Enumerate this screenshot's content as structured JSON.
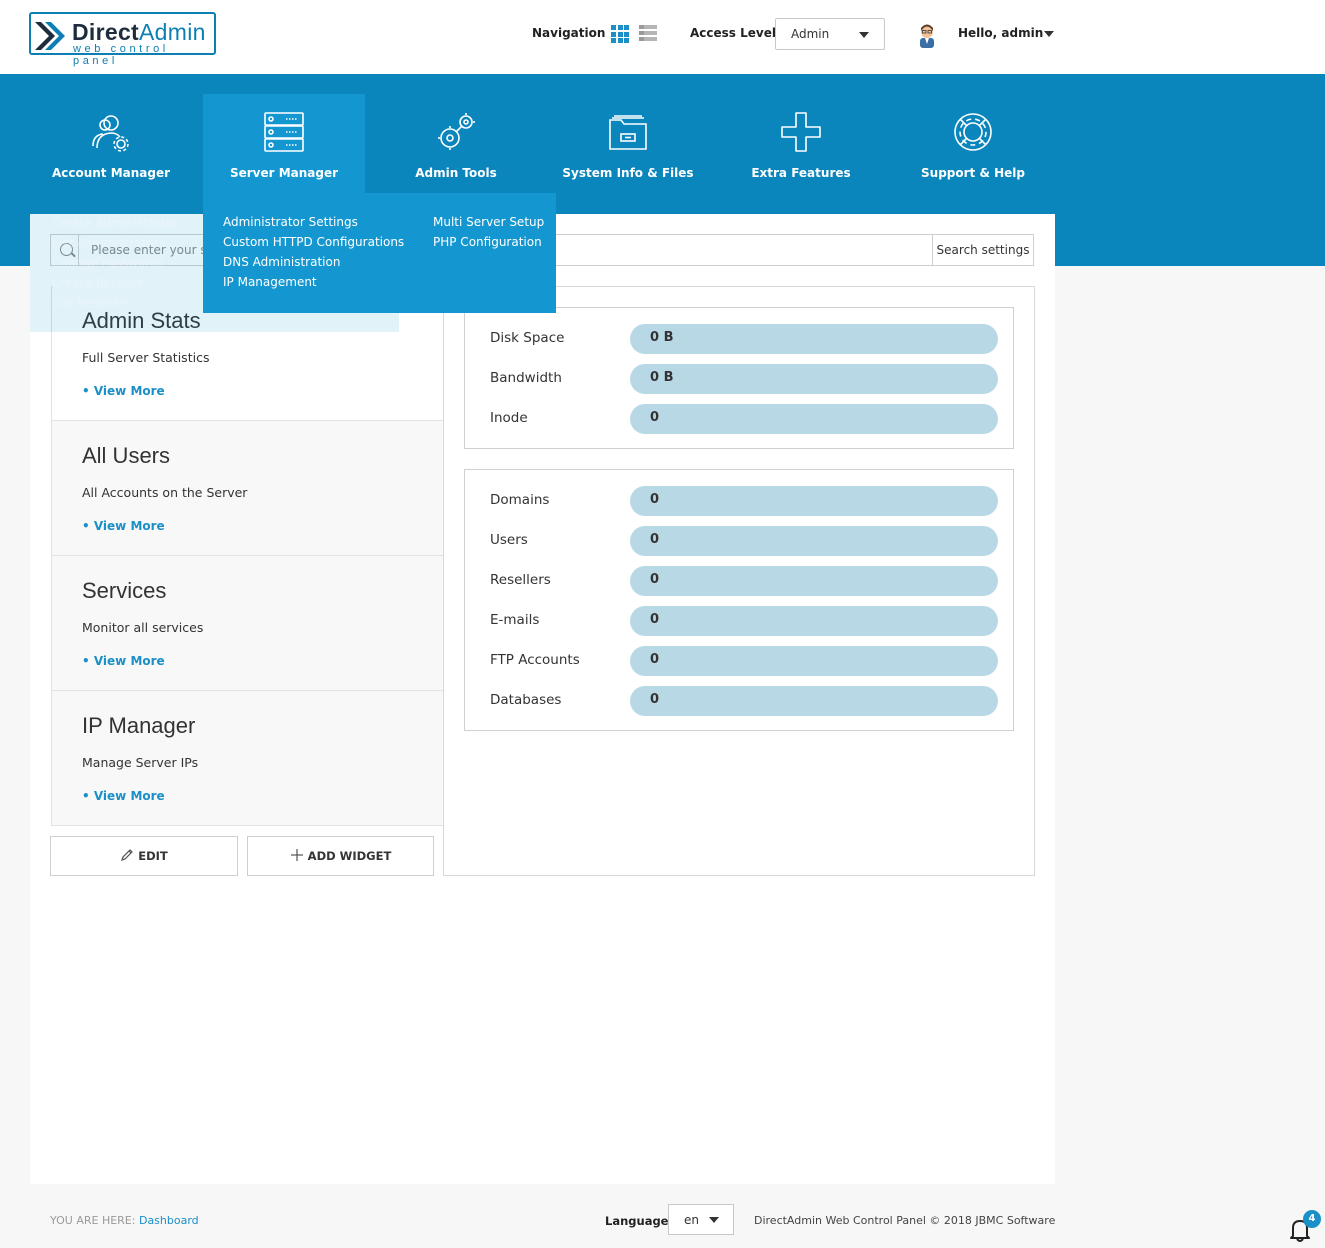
{
  "header": {
    "logo_brand_bold": "Direct",
    "logo_brand_light": "Admin",
    "logo_sub": "web control panel",
    "navigation_label": "Navigation",
    "access_level_label": "Access Level",
    "access_level_value": "Admin",
    "greeting": "Hello, admin"
  },
  "mainnav": [
    {
      "label": "Account Manager",
      "icon": "users-gear-icon"
    },
    {
      "label": "Server Manager",
      "icon": "server-icon",
      "active": true
    },
    {
      "label": "Admin Tools",
      "icon": "gears-icon"
    },
    {
      "label": "System Info & Files",
      "icon": "folder-icon"
    },
    {
      "label": "Extra Features",
      "icon": "plus-icon"
    },
    {
      "label": "Support & Help",
      "icon": "lifebuoy-icon"
    }
  ],
  "server_manager_menu": {
    "col1": [
      "Administrator Settings",
      "Custom HTTPD Configurations",
      "DNS Administration",
      "IP Management"
    ],
    "col2": [
      "Multi Server Setup",
      "PHP Configuration"
    ]
  },
  "account_manager_menu": [
    "Create Administrator",
    "List Administrators",
    "Change Passwords",
    "Create Reseller",
    "List Resellers"
  ],
  "search": {
    "placeholder": "Please enter your search",
    "button": "Search settings"
  },
  "widgets": [
    {
      "title": "Admin Stats",
      "desc": "Full Server Statistics",
      "link": "• View More"
    },
    {
      "title": "All Users",
      "desc": "All Accounts on the Server",
      "link": "• View More"
    },
    {
      "title": "Services",
      "desc": "Monitor all services",
      "link": "• View More"
    },
    {
      "title": "IP Manager",
      "desc": "Manage Server IPs",
      "link": "• View More"
    }
  ],
  "buttons": {
    "edit": "EDIT",
    "add_widget": "ADD WIDGET"
  },
  "usage_stats": [
    {
      "label": "Disk Space",
      "value": "0 B"
    },
    {
      "label": "Bandwidth",
      "value": "0 B"
    },
    {
      "label": "Inode",
      "value": "0"
    }
  ],
  "count_stats": [
    {
      "label": "Domains",
      "value": "0"
    },
    {
      "label": "Users",
      "value": "0"
    },
    {
      "label": "Resellers",
      "value": "0"
    },
    {
      "label": "E-mails",
      "value": "0"
    },
    {
      "label": "FTP Accounts",
      "value": "0"
    },
    {
      "label": "Databases",
      "value": "0"
    }
  ],
  "footer": {
    "you_are_here": "YOU ARE HERE:",
    "breadcrumb": "Dashboard",
    "language_label": "Language",
    "language_value": "en",
    "copyright": "DirectAdmin Web Control Panel © 2018 JBMC Software",
    "notification_count": "4"
  },
  "colors": {
    "banner": "#0b86bd",
    "menu_active": "#1497d0",
    "accent": "#1a8fc8",
    "bar": "#b9d8e5"
  }
}
